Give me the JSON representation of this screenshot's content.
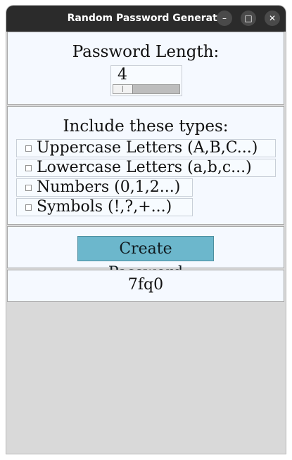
{
  "window": {
    "title": "Random Password Generator",
    "controls": {
      "minimize": "–",
      "maximize": "□",
      "close": "✕"
    }
  },
  "length_panel": {
    "title": "Password Length:",
    "value": "4",
    "slider_level": 0.0
  },
  "types_panel": {
    "title": "Include these types:",
    "options": [
      {
        "label": "Uppercase Letters (A,B,C...)",
        "checked": false
      },
      {
        "label": "Lowercase Letters (a,b,c...)",
        "checked": false
      },
      {
        "label": "Numbers (0,1,2...)",
        "checked": false
      },
      {
        "label": "Symbols (!,?,+...)",
        "checked": false
      }
    ]
  },
  "create": {
    "label": "Create Password",
    "color": "#6cb7cc"
  },
  "output": {
    "password": "7fq0"
  },
  "icons": {
    "minimize": "minimize-icon",
    "maximize": "maximize-icon",
    "close": "close-icon",
    "checkbox": "checkbox-icon"
  }
}
